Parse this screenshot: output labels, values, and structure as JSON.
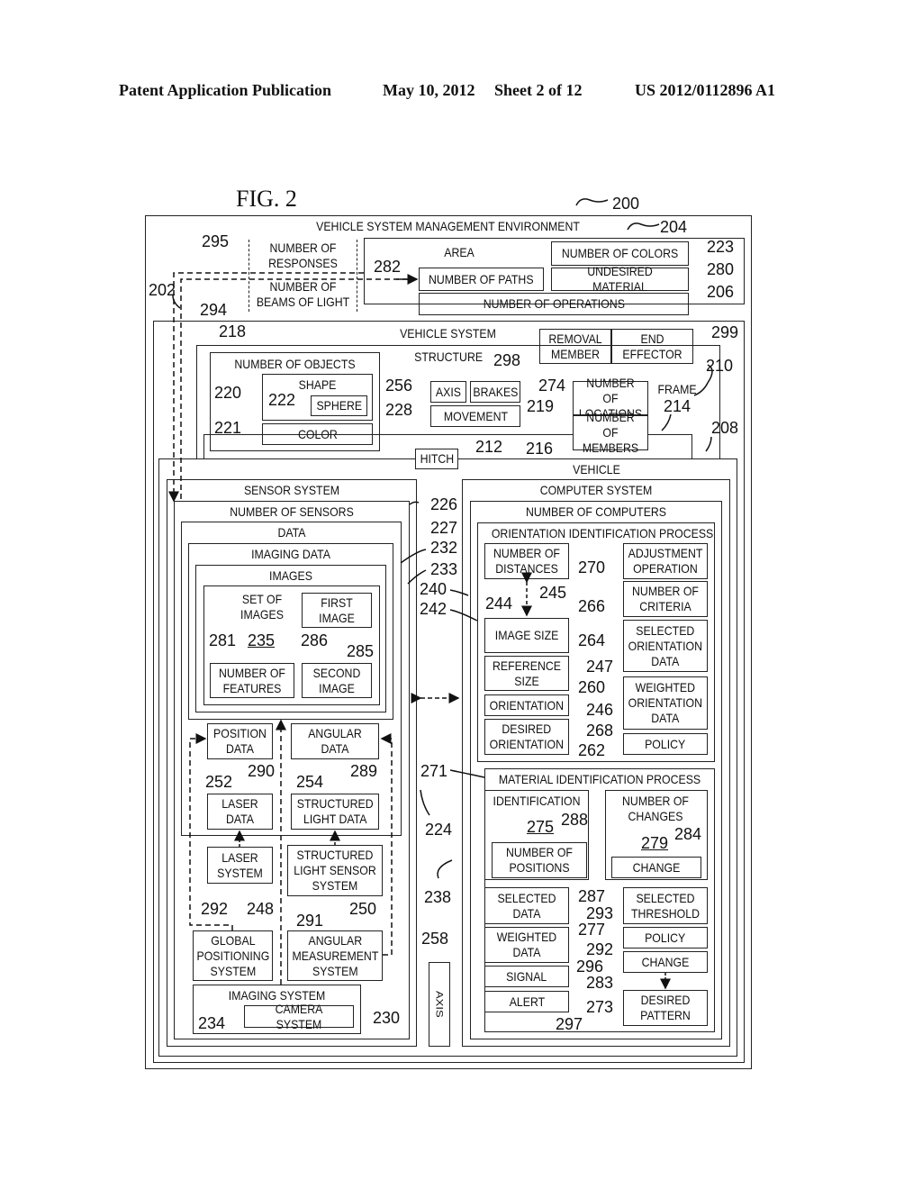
{
  "header": {
    "left": "Patent Application Publication",
    "date": "May 10, 2012",
    "sheet": "Sheet 2 of 12",
    "pub_number": "US 2012/0112896 A1"
  },
  "figure_title": "FIG. 2",
  "env": {
    "label": "VEHICLE SYSTEM MANAGEMENT ENVIRONMENT",
    "ref": "200"
  },
  "area": {
    "label": "AREA",
    "ref": "204",
    "colors": {
      "label": "NUMBER OF COLORS",
      "ref": "223"
    },
    "paths": {
      "label": "NUMBER OF PATHS",
      "ref": "282"
    },
    "undesired": {
      "label": "UNDESIRED MATERIAL",
      "ref": "280"
    },
    "operations": {
      "label": "NUMBER OF OPERATIONS",
      "ref": "206"
    }
  },
  "responses": {
    "label": "NUMBER OF RESPONSES",
    "ref": "295"
  },
  "beams": {
    "label": "NUMBER OF BEAMS OF LIGHT",
    "ref": "294"
  },
  "vehicle_system": {
    "label": "VEHICLE SYSTEM",
    "ref": "202"
  },
  "structure": {
    "label": "STRUCTURE",
    "ref": "210"
  },
  "removal": {
    "member": "REMOVAL MEMBER",
    "member_ref": "298",
    "effector": "END EFFECTOR",
    "effector_ref": "299"
  },
  "objects": {
    "label": "NUMBER OF OBJECTS",
    "ref": "218",
    "shape": {
      "label": "SHAPE",
      "ref": "220"
    },
    "sphere": {
      "label": "SPHERE",
      "ref": "222"
    },
    "color": {
      "label": "COLOR",
      "ref": "221"
    }
  },
  "axis_top": {
    "label": "AXIS",
    "ref": "256"
  },
  "brakes": {
    "label": "BRAKES",
    "ref": "274"
  },
  "movement": {
    "label": "MOVEMENT",
    "ref": "228"
  },
  "locations": {
    "label": "NUMBER OF LOCATIONS",
    "ref": "219"
  },
  "members": {
    "label": "NUMBER OF MEMBERS",
    "ref": "216"
  },
  "frame": {
    "label": "FRAME",
    "ref": "214"
  },
  "hitch": {
    "label": "HITCH",
    "ref": "212"
  },
  "vehicle": {
    "label": "VEHICLE",
    "ref": "208"
  },
  "sensor_system": {
    "label": "SENSOR SYSTEM",
    "ref": "224",
    "sensors": {
      "label": "NUMBER OF SENSORS",
      "ref": "226"
    },
    "data": {
      "label": "DATA",
      "ref": "227"
    },
    "imaging_data": {
      "label": "IMAGING DATA",
      "ref": "232"
    },
    "images": {
      "label": "IMAGES",
      "ref": "233"
    },
    "set_of_images": {
      "label": "SET OF IMAGES",
      "ref": "235"
    },
    "first_image": {
      "label": "FIRST IMAGE",
      "ref": "285"
    },
    "features": {
      "label": "NUMBER OF FEATURES",
      "ref": "281"
    },
    "second_image": {
      "label": "SECOND IMAGE",
      "ref": "286"
    },
    "position_data": {
      "label": "POSITION DATA",
      "ref": "252"
    },
    "angular_data": {
      "label": "ANGULAR DATA",
      "ref": "254"
    },
    "laser_data": {
      "label": "LASER DATA",
      "ref": "290"
    },
    "sl_data": {
      "label": "STRUCTURED LIGHT DATA",
      "ref": "289"
    },
    "laser_system": {
      "label": "LASER SYSTEM",
      "ref": "292"
    },
    "sl_sensor": {
      "label": "STRUCTURED LIGHT SENSOR SYSTEM",
      "ref": "291"
    },
    "gps": {
      "label": "GLOBAL POSITIONING SYSTEM",
      "ref": "248"
    },
    "ams": {
      "label": "ANGULAR MEASUREMENT SYSTEM",
      "ref": "250"
    },
    "imaging_system": {
      "label": "IMAGING SYSTEM",
      "ref": "230"
    },
    "camera": {
      "label": "CAMERA SYSTEM",
      "ref": "234"
    }
  },
  "axis_bottom": {
    "label": "AXIS",
    "ref": "258"
  },
  "computer_system": {
    "label": "COMPUTER SYSTEM",
    "ref": "238",
    "computers": {
      "label": "NUMBER OF COMPUTERS",
      "ref": "240"
    },
    "oip": {
      "label": "ORIENTATION IDENTIFICATION PROCESS",
      "ref": "242"
    },
    "distances": {
      "label": "NUMBER OF DISTANCES",
      "ref": "244"
    },
    "arrow_ref": "245",
    "image_size": {
      "label": "IMAGE SIZE"
    },
    "reference_size": {
      "label": "REFERENCE SIZE",
      "ref": "247"
    },
    "orientation": {
      "label": "ORIENTATION",
      "ref": "246"
    },
    "desired_orientation": {
      "label": "DESIRED ORIENTATION",
      "ref": "268"
    },
    "adjustment": {
      "label": "ADJUSTMENT OPERATION",
      "ref": "270"
    },
    "criteria": {
      "label": "NUMBER OF CRITERIA",
      "ref": "266"
    },
    "selected_orientation": {
      "label": "SELECTED ORIENTATION DATA",
      "ref": "264"
    },
    "weighted_orientation": {
      "label": "WEIGHTED ORIENTATION DATA",
      "ref": "260"
    },
    "policy1": {
      "label": "POLICY",
      "ref": "262"
    },
    "mip": {
      "label": "MATERIAL IDENTIFICATION PROCESS",
      "ref": "271"
    },
    "identification": {
      "label": "IDENTIFICATION",
      "ref": "275"
    },
    "positions": {
      "label": "NUMBER OF POSITIONS",
      "ref": "288"
    },
    "changes": {
      "label": "NUMBER OF CHANGES",
      "ref": "279"
    },
    "change1": {
      "label": "CHANGE",
      "ref": "284"
    },
    "selected_data": {
      "label": "SELECTED DATA",
      "ref": "293"
    },
    "selected_threshold": {
      "label": "SELECTED THRESHOLD",
      "ref": "287"
    },
    "weighted_data": {
      "label": "WEIGHTED DATA",
      "ref": "292"
    },
    "policy2": {
      "label": "POLICY",
      "ref": "277"
    },
    "signal": {
      "label": "SIGNAL",
      "ref": "283"
    },
    "change2": {
      "label": "CHANGE",
      "ref": "296"
    },
    "alert": {
      "label": "ALERT",
      "ref": "273"
    },
    "desired_pattern": {
      "label": "DESIRED PATTERN",
      "ref": "297"
    }
  }
}
